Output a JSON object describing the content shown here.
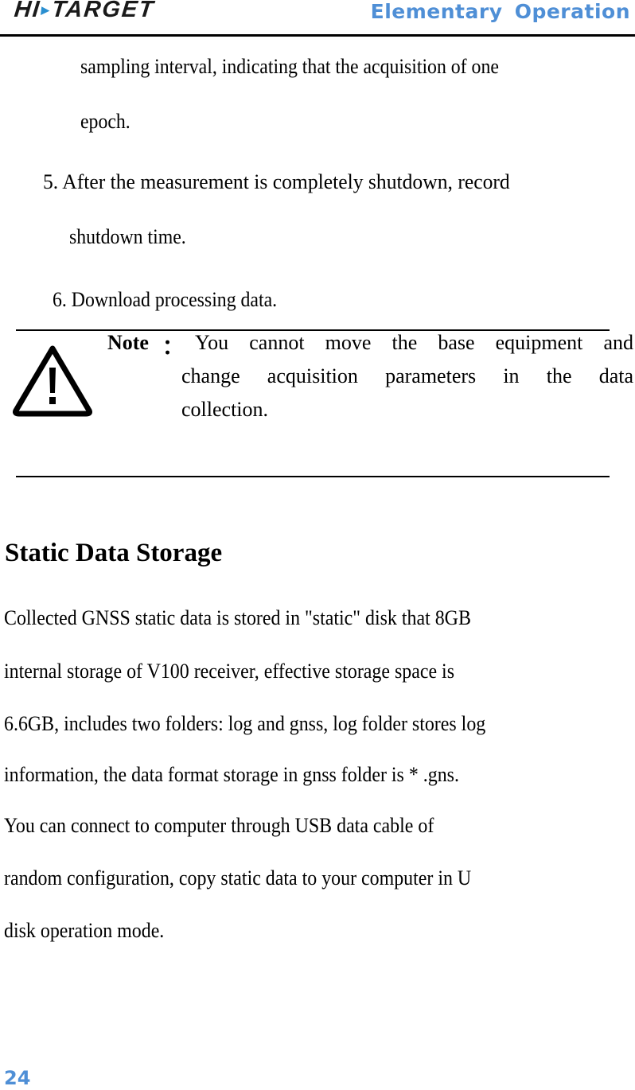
{
  "header": {
    "logo_left": "HI",
    "logo_right": "TARGET",
    "section_title": "Elementary  Operation"
  },
  "body": {
    "continuation": [
      "sampling interval, indicating that the acquisition of one",
      "epoch."
    ],
    "steps": [
      {
        "line1": "5. After the measurement is completely shutdown, record",
        "line2": "shutdown time."
      },
      {
        "line1": "6. Download processing data."
      }
    ]
  },
  "note": {
    "icon": "warning-icon",
    "label": "Note",
    "colon": "：",
    "lines": [
      "You cannot move the base equipment and",
      "change acquisition parameters in the data",
      "collection."
    ]
  },
  "section": {
    "heading": "Static Data Storage",
    "paragraph_lines": [
      "Collected GNSS static data is stored in \"static\" disk that 8GB",
      "internal storage of V100 receiver, effective storage space is",
      "6.6GB, includes two folders: log and gnss, log folder stores log",
      "information, the data format storage in gnss folder is * .gns.",
      "You can connect to computer through USB data cable of",
      "random configuration, copy static data to your computer in U",
      "disk operation mode."
    ]
  },
  "footer": {
    "page_number": "24"
  },
  "colors": {
    "accent": "#4f8fd6",
    "logo_triangle": "#2a8fd0"
  }
}
